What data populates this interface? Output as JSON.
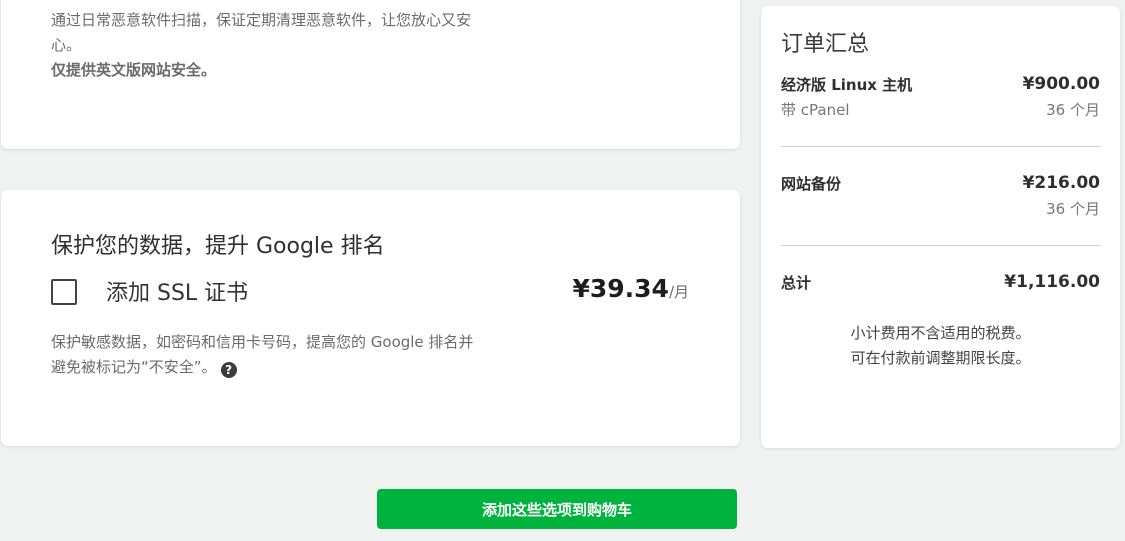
{
  "top_card": {
    "description": "通过日常恶意软件扫描，保证定期清理恶意软件，让您放心又安心。",
    "note": "仅提供英文版网站安全。"
  },
  "ssl_card": {
    "heading": "保护您的数据，提升 Google 排名",
    "option_label": "添加 SSL 证书",
    "checked": false,
    "price": "¥39.34",
    "price_unit": "/月",
    "description": "保护敏感数据，如密码和信用卡号码，提高您的 Google 排名并避免被标记为“不安全”。",
    "help_icon": "question-circle-icon",
    "help_glyph": "?"
  },
  "summary": {
    "title": "订单汇总",
    "items": [
      {
        "name": "经济版 Linux 主机",
        "sub": "带 cPanel",
        "price": "¥900.00",
        "term": "36 个月"
      },
      {
        "name": "网站备份",
        "price": "¥216.00",
        "term": "36 个月"
      }
    ],
    "total_label": "总计",
    "total_value": "¥1,116.00",
    "note_lines": [
      "小计费用不含适用的税费。",
      "可在付款前调整期限长度。"
    ]
  },
  "cta": {
    "label": "添加这些选项到购物车"
  },
  "colors": {
    "accent_green": "#00b33c",
    "background": "#f0f1f1",
    "card": "#ffffff"
  }
}
